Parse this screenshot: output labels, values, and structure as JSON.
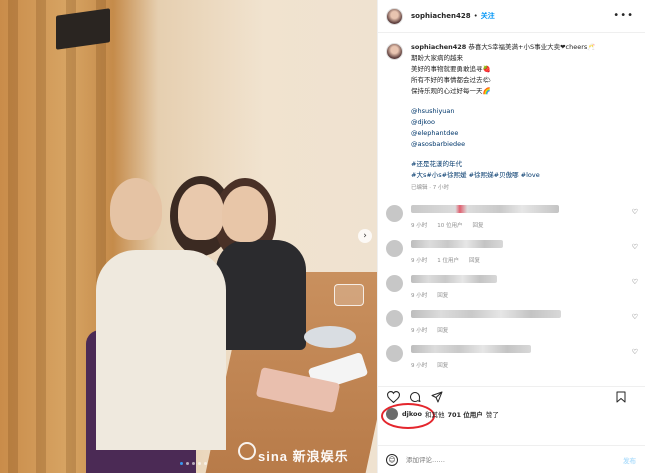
{
  "post": {
    "username": "sophiachen428",
    "follow_label": "关注",
    "more_icon": "more-horizontal-icon",
    "dot": "•"
  },
  "caption": {
    "username": "sophiachen428",
    "lines": [
      "恭喜大S幸福美满+小S事业大卖❤cheers🥂",
      "期盼大家病的越来",
      "美好的事物就要勇敢追寻🍓",
      "所有不好的事情都会过去🌤",
      "保持乐观的心过好每一天🌈"
    ],
    "mentions": [
      "@hsushiyuan",
      "@djkoo",
      "@elephantdee",
      "@asosbarbiedee"
    ],
    "hashtags_line1": "#还是花漾的年代",
    "hashtags_line2": "#大s#小s#徐熙媛 #徐熙娣#贝傲哪 #love",
    "time": "已编辑 · 7 小时"
  },
  "comments": [
    {
      "time": "9 小时",
      "likes": "10 位用户",
      "reply": "回复"
    },
    {
      "time": "9 小时",
      "likes": "1 位用户",
      "reply": "回复"
    },
    {
      "time": "9 小时",
      "likes": "",
      "reply": "回复"
    },
    {
      "time": "9 小时",
      "likes": "",
      "reply": "回复"
    },
    {
      "time": "9 小时",
      "likes": "",
      "reply": "回复"
    }
  ],
  "likes": {
    "user": "djkoo",
    "conj": "和其他",
    "count": "701 位用户",
    "suffix": "赞了"
  },
  "comment_box": {
    "placeholder": "添加评论……",
    "post_label": "发布"
  },
  "watermark": {
    "text": "sina 新浪娱乐"
  },
  "colors": {
    "link": "#00376b",
    "follow": "#0095f6",
    "annotation": "#e4262d"
  }
}
